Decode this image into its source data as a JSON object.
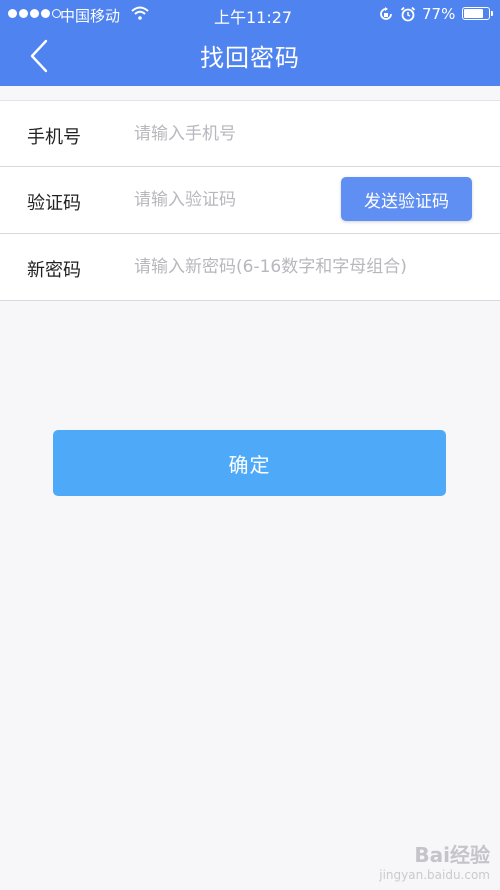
{
  "status_bar": {
    "carrier": "中国移动",
    "time": "上午11:27",
    "battery": "77%"
  },
  "nav": {
    "title": "找回密码"
  },
  "form": {
    "phone": {
      "label": "手机号",
      "placeholder": "请输入手机号"
    },
    "code": {
      "label": "验证码",
      "placeholder": "请输入验证码",
      "send_label": "发送验证码"
    },
    "password": {
      "label": "新密码",
      "placeholder": "请输入新密码(6-16数字和字母组合)"
    }
  },
  "confirm_label": "确定",
  "watermark": {
    "logo": "Bai经验",
    "url": "jingyan.baidu.com"
  },
  "colors": {
    "nav_bg": "#4f83f0",
    "send_button": "#5f8ff2",
    "confirm_button": "#4eaaf8"
  },
  "icons": [
    "signal-icon",
    "wifi-icon",
    "rotation-lock-icon",
    "alarm-icon",
    "battery-icon",
    "back-arrow-icon"
  ]
}
